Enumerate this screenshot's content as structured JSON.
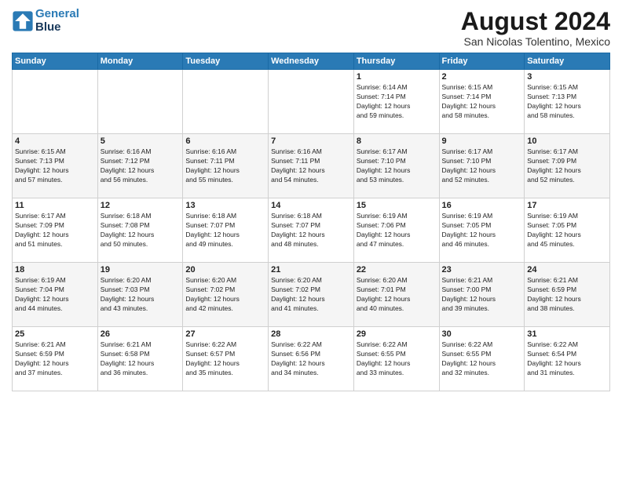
{
  "header": {
    "logo_line1": "General",
    "logo_line2": "Blue",
    "month_year": "August 2024",
    "location": "San Nicolas Tolentino, Mexico"
  },
  "weekdays": [
    "Sunday",
    "Monday",
    "Tuesday",
    "Wednesday",
    "Thursday",
    "Friday",
    "Saturday"
  ],
  "weeks": [
    [
      {
        "day": "",
        "info": ""
      },
      {
        "day": "",
        "info": ""
      },
      {
        "day": "",
        "info": ""
      },
      {
        "day": "",
        "info": ""
      },
      {
        "day": "1",
        "info": "Sunrise: 6:14 AM\nSunset: 7:14 PM\nDaylight: 12 hours\nand 59 minutes."
      },
      {
        "day": "2",
        "info": "Sunrise: 6:15 AM\nSunset: 7:14 PM\nDaylight: 12 hours\nand 58 minutes."
      },
      {
        "day": "3",
        "info": "Sunrise: 6:15 AM\nSunset: 7:13 PM\nDaylight: 12 hours\nand 58 minutes."
      }
    ],
    [
      {
        "day": "4",
        "info": "Sunrise: 6:15 AM\nSunset: 7:13 PM\nDaylight: 12 hours\nand 57 minutes."
      },
      {
        "day": "5",
        "info": "Sunrise: 6:16 AM\nSunset: 7:12 PM\nDaylight: 12 hours\nand 56 minutes."
      },
      {
        "day": "6",
        "info": "Sunrise: 6:16 AM\nSunset: 7:11 PM\nDaylight: 12 hours\nand 55 minutes."
      },
      {
        "day": "7",
        "info": "Sunrise: 6:16 AM\nSunset: 7:11 PM\nDaylight: 12 hours\nand 54 minutes."
      },
      {
        "day": "8",
        "info": "Sunrise: 6:17 AM\nSunset: 7:10 PM\nDaylight: 12 hours\nand 53 minutes."
      },
      {
        "day": "9",
        "info": "Sunrise: 6:17 AM\nSunset: 7:10 PM\nDaylight: 12 hours\nand 52 minutes."
      },
      {
        "day": "10",
        "info": "Sunrise: 6:17 AM\nSunset: 7:09 PM\nDaylight: 12 hours\nand 52 minutes."
      }
    ],
    [
      {
        "day": "11",
        "info": "Sunrise: 6:17 AM\nSunset: 7:09 PM\nDaylight: 12 hours\nand 51 minutes."
      },
      {
        "day": "12",
        "info": "Sunrise: 6:18 AM\nSunset: 7:08 PM\nDaylight: 12 hours\nand 50 minutes."
      },
      {
        "day": "13",
        "info": "Sunrise: 6:18 AM\nSunset: 7:07 PM\nDaylight: 12 hours\nand 49 minutes."
      },
      {
        "day": "14",
        "info": "Sunrise: 6:18 AM\nSunset: 7:07 PM\nDaylight: 12 hours\nand 48 minutes."
      },
      {
        "day": "15",
        "info": "Sunrise: 6:19 AM\nSunset: 7:06 PM\nDaylight: 12 hours\nand 47 minutes."
      },
      {
        "day": "16",
        "info": "Sunrise: 6:19 AM\nSunset: 7:05 PM\nDaylight: 12 hours\nand 46 minutes."
      },
      {
        "day": "17",
        "info": "Sunrise: 6:19 AM\nSunset: 7:05 PM\nDaylight: 12 hours\nand 45 minutes."
      }
    ],
    [
      {
        "day": "18",
        "info": "Sunrise: 6:19 AM\nSunset: 7:04 PM\nDaylight: 12 hours\nand 44 minutes."
      },
      {
        "day": "19",
        "info": "Sunrise: 6:20 AM\nSunset: 7:03 PM\nDaylight: 12 hours\nand 43 minutes."
      },
      {
        "day": "20",
        "info": "Sunrise: 6:20 AM\nSunset: 7:02 PM\nDaylight: 12 hours\nand 42 minutes."
      },
      {
        "day": "21",
        "info": "Sunrise: 6:20 AM\nSunset: 7:02 PM\nDaylight: 12 hours\nand 41 minutes."
      },
      {
        "day": "22",
        "info": "Sunrise: 6:20 AM\nSunset: 7:01 PM\nDaylight: 12 hours\nand 40 minutes."
      },
      {
        "day": "23",
        "info": "Sunrise: 6:21 AM\nSunset: 7:00 PM\nDaylight: 12 hours\nand 39 minutes."
      },
      {
        "day": "24",
        "info": "Sunrise: 6:21 AM\nSunset: 6:59 PM\nDaylight: 12 hours\nand 38 minutes."
      }
    ],
    [
      {
        "day": "25",
        "info": "Sunrise: 6:21 AM\nSunset: 6:59 PM\nDaylight: 12 hours\nand 37 minutes."
      },
      {
        "day": "26",
        "info": "Sunrise: 6:21 AM\nSunset: 6:58 PM\nDaylight: 12 hours\nand 36 minutes."
      },
      {
        "day": "27",
        "info": "Sunrise: 6:22 AM\nSunset: 6:57 PM\nDaylight: 12 hours\nand 35 minutes."
      },
      {
        "day": "28",
        "info": "Sunrise: 6:22 AM\nSunset: 6:56 PM\nDaylight: 12 hours\nand 34 minutes."
      },
      {
        "day": "29",
        "info": "Sunrise: 6:22 AM\nSunset: 6:55 PM\nDaylight: 12 hours\nand 33 minutes."
      },
      {
        "day": "30",
        "info": "Sunrise: 6:22 AM\nSunset: 6:55 PM\nDaylight: 12 hours\nand 32 minutes."
      },
      {
        "day": "31",
        "info": "Sunrise: 6:22 AM\nSunset: 6:54 PM\nDaylight: 12 hours\nand 31 minutes."
      }
    ]
  ]
}
